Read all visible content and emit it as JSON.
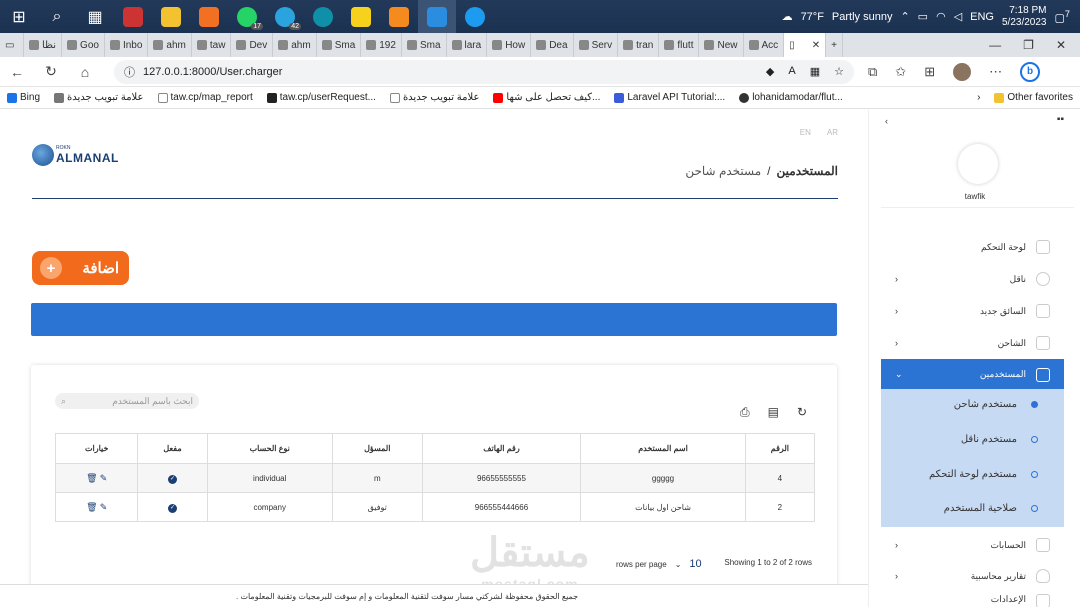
{
  "taskbar": {
    "weather": "77°F",
    "weather_desc": "Partly sunny",
    "lang": "ENG",
    "time": "7:18 PM",
    "date": "5/23/2023",
    "notif_count": "7",
    "whatsapp_badge": "17",
    "telegram_badge": "42"
  },
  "tabs": [
    "نظا",
    "Goo",
    "Inbo",
    "ahm",
    "taw",
    "Dev",
    "ahm",
    "Sma",
    "192",
    "Sma",
    "lara",
    "How",
    "Dea",
    "Serv",
    "tran",
    "flutt",
    "New",
    "Acc"
  ],
  "address": {
    "url": "127.0.0.1:8000/User.charger"
  },
  "favorites": {
    "bing": "Bing",
    "f1": "علامة تبويب جديدة",
    "f2": "taw.cp/map_report",
    "f3": "taw.cp/userRequest...",
    "f4": "علامة تبويب جديدة",
    "f5": "كيف تحصل على شها...",
    "f6": "Laravel API Tutorial:...",
    "f7": "lohanidamodar/flut...",
    "other": "Other favorites"
  },
  "header": {
    "lang_en": "EN",
    "lang_ar": "AR",
    "logo_small": "ROKN",
    "logo_text": "ALMANAL",
    "crumb_root": "المستخدمين",
    "crumb_sep": "/",
    "crumb_current": "مستخدم شاحن"
  },
  "add_button": "اضافة",
  "search_placeholder": "ابحث باسم المستخدم",
  "table": {
    "headers": [
      "الرقم",
      "اسم المستخدم",
      "رقم الهاتف",
      "المسؤل",
      "نوع الحساب",
      "مفعل",
      "خيارات"
    ],
    "rows": [
      {
        "id": "4",
        "name": "ggggg",
        "phone": "96655555555",
        "responsible": "m",
        "type": "individual"
      },
      {
        "id": "2",
        "name": "شاحن اول بيانات",
        "phone": "966555444666",
        "responsible": "توفيق",
        "type": "company"
      }
    ]
  },
  "pager": {
    "rows_per_page": "rows per page",
    "size": "10",
    "info": "Showing 1 to 2 of 2 rows"
  },
  "footer": "جميع الحقوق محفوظة لشركتي مسار سوفت لتقنية المعلومات و إم سوفت للبرمجيات وتقنية المعلومات .",
  "watermark": {
    "ar": "مستقل",
    "en": "mostaql.com"
  },
  "sidebar": {
    "user": "tawfik",
    "items": [
      "لوحة التحكم",
      "ناقل",
      "السائق جديد",
      "الشاحن",
      "المستخدمين",
      "الحسابات",
      "تقارير محاسبية",
      "الإعدادات"
    ],
    "sub": [
      "مستخدم شاحن",
      "مستخدم ناقل",
      "مستخدم لوحة التحكم",
      "صلاحية المستخدم"
    ]
  }
}
